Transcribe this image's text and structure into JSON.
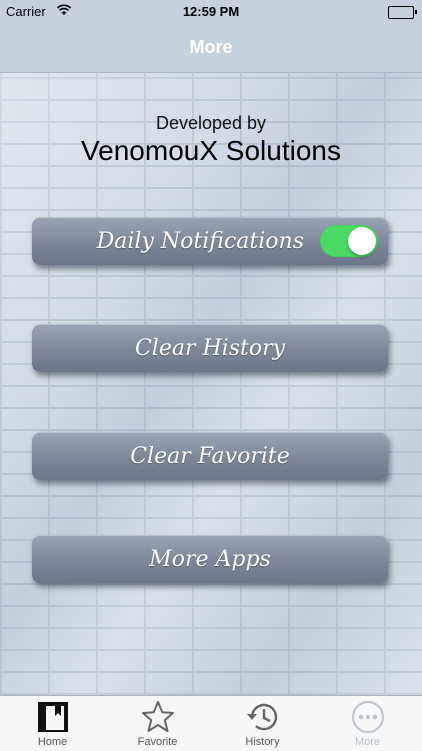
{
  "status_bar": {
    "carrier": "Carrier",
    "time": "12:59 PM"
  },
  "nav": {
    "title": "More"
  },
  "credits": {
    "developed_by": "Developed by",
    "company": "VenomouX Solutions"
  },
  "menu": {
    "daily_notifications": {
      "label": "Daily Notifications",
      "enabled": true
    },
    "clear_history": "Clear History",
    "clear_favorite": "Clear Favorite",
    "more_apps": "More Apps"
  },
  "tabs": [
    {
      "label": "Home",
      "icon": "book-icon"
    },
    {
      "label": "Favorite",
      "icon": "star-icon"
    },
    {
      "label": "History",
      "icon": "history-icon"
    },
    {
      "label": "More",
      "icon": "more-icon",
      "active": true
    }
  ],
  "colors": {
    "toggle_on": "#4cd964",
    "button": "#7c8799",
    "tab_active": "#b9c3cf"
  }
}
